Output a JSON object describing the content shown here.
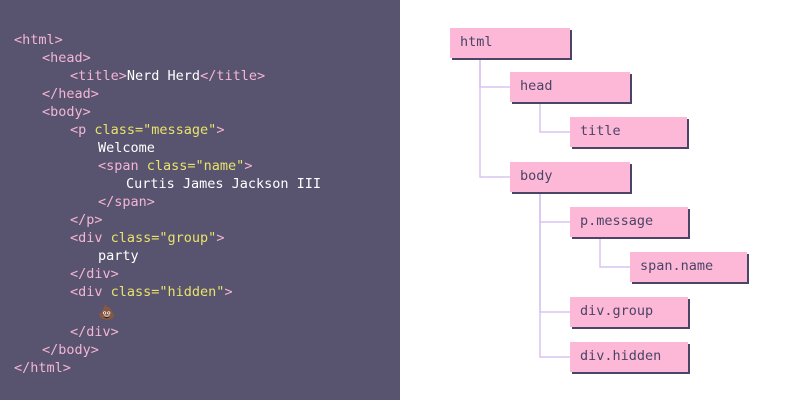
{
  "code": {
    "lines": [
      [
        {
          "t": "tag",
          "s": "<html>"
        }
      ],
      [
        {
          "t": "tag",
          "s": "<head>"
        }
      ],
      [
        {
          "t": "tag",
          "s": "<title>"
        },
        {
          "t": "text",
          "s": "Nerd Herd"
        },
        {
          "t": "tag",
          "s": "</title>"
        }
      ],
      [
        {
          "t": "tag",
          "s": "</head>"
        }
      ],
      [
        {
          "t": "tag",
          "s": "<body>"
        }
      ],
      [
        {
          "t": "tag",
          "s": "<p "
        },
        {
          "t": "attr",
          "s": "class=\"message\""
        },
        {
          "t": "tag",
          "s": ">"
        }
      ],
      [
        {
          "t": "text",
          "s": "Welcome"
        }
      ],
      [
        {
          "t": "tag",
          "s": "<span "
        },
        {
          "t": "attr",
          "s": "class=\"name\""
        },
        {
          "t": "tag",
          "s": ">"
        }
      ],
      [
        {
          "t": "text",
          "s": "Curtis James Jackson III"
        }
      ],
      [
        {
          "t": "tag",
          "s": "</span>"
        }
      ],
      [
        {
          "t": "tag",
          "s": "</p>"
        }
      ],
      [
        {
          "t": "tag",
          "s": "<div "
        },
        {
          "t": "attr",
          "s": "class=\"group\""
        },
        {
          "t": "tag",
          "s": ">"
        }
      ],
      [
        {
          "t": "text",
          "s": "party"
        }
      ],
      [
        {
          "t": "tag",
          "s": "</div>"
        }
      ],
      [
        {
          "t": "tag",
          "s": "<div "
        },
        {
          "t": "attr",
          "s": "class=\"hidden\""
        },
        {
          "t": "tag",
          "s": ">"
        }
      ],
      [
        {
          "t": "emoji",
          "s": "💩"
        }
      ],
      [
        {
          "t": "tag",
          "s": "</div>"
        }
      ],
      [
        {
          "t": "tag",
          "s": "</body>"
        }
      ],
      [
        {
          "t": "tag",
          "s": "</html>"
        }
      ]
    ]
  },
  "tree": {
    "html": "html",
    "head": "head",
    "title": "title",
    "body": "body",
    "p_message": "p.message",
    "span_name": "span.name",
    "div_group": "div.group",
    "div_hidden": "div.hidden"
  },
  "colors": {
    "code_background": "#58536f",
    "tag": "#f4b6d5",
    "attribute": "#e9e36a",
    "text": "#ffffff",
    "node_fill": "#fdb8d7",
    "node_shadow": "#4a4466",
    "connector": "#d9c4f0"
  }
}
